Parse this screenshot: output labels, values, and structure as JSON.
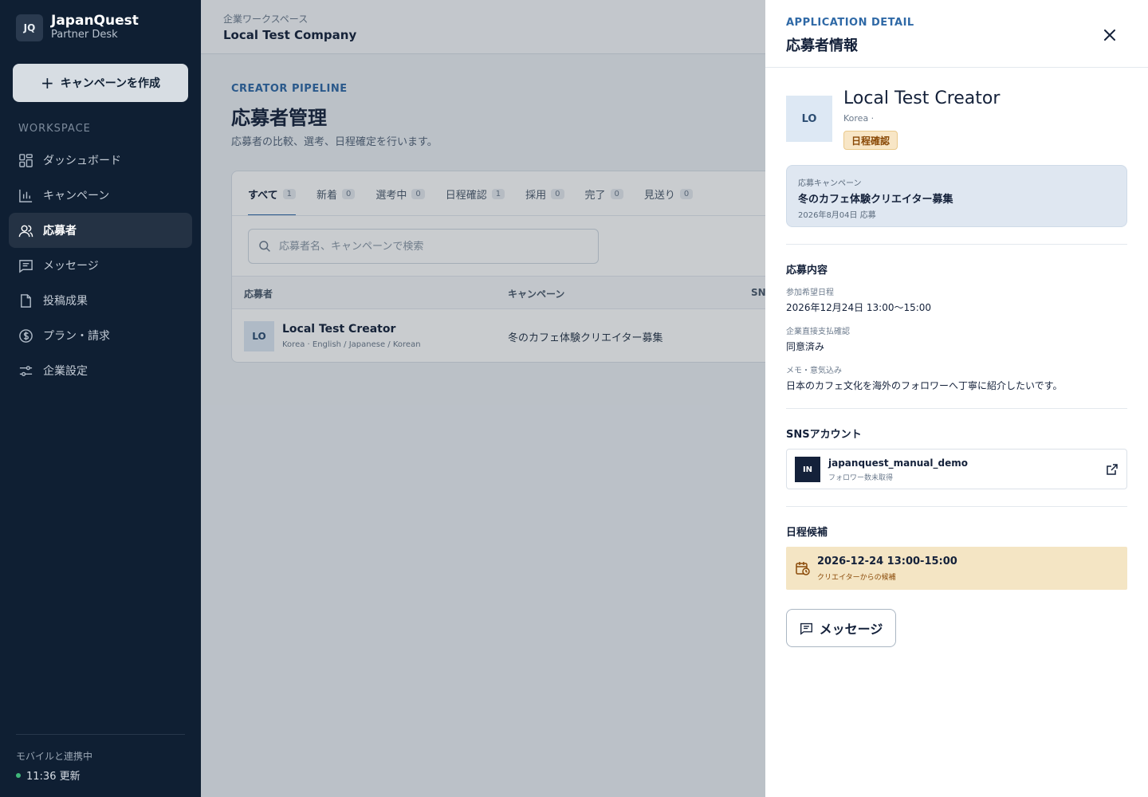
{
  "sidebar": {
    "brand_logo": "JQ",
    "brand_name": "JapanQuest",
    "brand_sub": "Partner Desk",
    "create_button": "キャンペーンを作成",
    "workspace_label": "WORKSPACE",
    "items": [
      {
        "label": "ダッシュボード",
        "icon": "dashboard-icon"
      },
      {
        "label": "キャンペーン",
        "icon": "chart-icon"
      },
      {
        "label": "応募者",
        "icon": "users-icon",
        "active": true
      },
      {
        "label": "メッセージ",
        "icon": "message-icon"
      },
      {
        "label": "投稿成果",
        "icon": "file-icon"
      },
      {
        "label": "プラン・請求",
        "icon": "dollar-icon"
      },
      {
        "label": "企業設定",
        "icon": "sliders-icon"
      }
    ],
    "sync_label": "モバイルと連携中",
    "sync_time": "11:36 更新"
  },
  "topbar": {
    "kicker": "企業ワークスペース",
    "company": "Local Test Company"
  },
  "page": {
    "kicker": "CREATOR PIPELINE",
    "title": "応募者管理",
    "subtitle": "応募者の比較、選考、日程確定を行います。"
  },
  "tabs": [
    {
      "label": "すべて",
      "count": "1"
    },
    {
      "label": "新着",
      "count": "0"
    },
    {
      "label": "選考中",
      "count": "0"
    },
    {
      "label": "日程確認",
      "count": "1"
    },
    {
      "label": "採用",
      "count": "0"
    },
    {
      "label": "完了",
      "count": "0"
    },
    {
      "label": "見送り",
      "count": "0"
    }
  ],
  "search": {
    "placeholder": "応募者名、キャンペーンで検索"
  },
  "table": {
    "headers": [
      "応募者",
      "キャンペーン",
      "SN"
    ],
    "rows": [
      {
        "avatar": "LO",
        "name": "Local Test Creator",
        "meta": "Korea · English / Japanese / Korean",
        "campaign": "冬のカフェ体験クリエイター募集"
      }
    ]
  },
  "drawer": {
    "kicker": "APPLICATION DETAIL",
    "title": "応募者情報",
    "profile": {
      "avatar": "LO",
      "name": "Local Test Creator",
      "country": "Korea ·",
      "status": "日程確認"
    },
    "campaign": {
      "label": "応募キャンペーン",
      "title": "冬のカフェ体験クリエイター募集",
      "date": "2026年8月04日 応募"
    },
    "application": {
      "section_title": "応募内容",
      "fields": [
        {
          "label": "参加希望日程",
          "value": "2026年12月24日 13:00〜15:00"
        },
        {
          "label": "企業直接支払確認",
          "value": "同意済み"
        },
        {
          "label": "メモ・意気込み",
          "value": "日本のカフェ文化を海外のフォロワーへ丁寧に紹介したいです。"
        }
      ]
    },
    "sns": {
      "section_title": "SNSアカウント",
      "icon_label": "IN",
      "handle": "japanquest_manual_demo",
      "followers": "フォロワー数未取得"
    },
    "schedule": {
      "section_title": "日程候補",
      "time": "2026-12-24 13:00-15:00",
      "sub": "クリエイターからの候補"
    },
    "message_button": "メッセージ"
  }
}
